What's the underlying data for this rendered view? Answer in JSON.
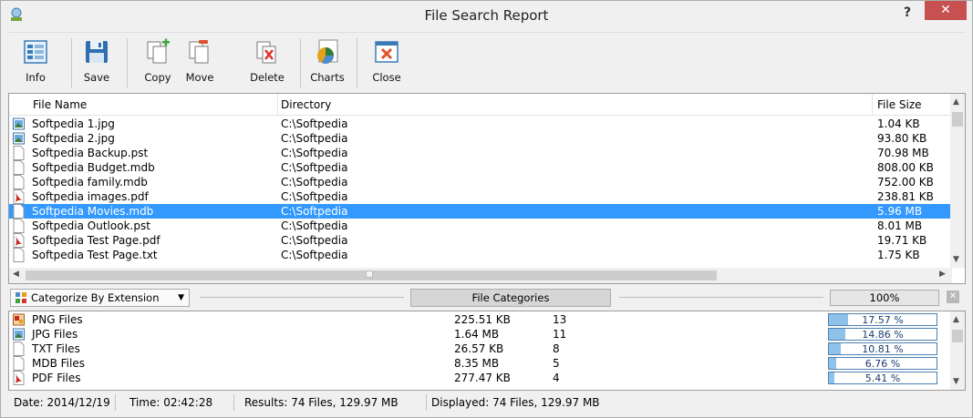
{
  "window": {
    "title": "File Search Report",
    "help_label": "?",
    "close_label": "✕"
  },
  "toolbar": {
    "buttons": [
      {
        "label": "Info",
        "icon": "info-icon"
      },
      {
        "label": "Save",
        "icon": "floppy-disk-icon"
      },
      {
        "label": "Copy",
        "icon": "copy-files-icon"
      },
      {
        "label": "Move",
        "icon": "move-files-icon"
      },
      {
        "label": "Delete",
        "icon": "delete-files-icon"
      },
      {
        "label": "Charts",
        "icon": "pie-chart-icon"
      },
      {
        "label": "Close",
        "icon": "close-window-icon"
      }
    ]
  },
  "files": {
    "columns": {
      "name": "File Name",
      "directory": "Directory",
      "size": "File Size"
    },
    "rows": [
      {
        "name": "Softpedia 1.jpg",
        "directory": "C:\\Softpedia",
        "size": "1.04 KB",
        "icon": "image-file-icon"
      },
      {
        "name": "Softpedia 2.jpg",
        "directory": "C:\\Softpedia",
        "size": "93.80 KB",
        "icon": "image-file-icon"
      },
      {
        "name": "Softpedia Backup.pst",
        "directory": "C:\\Softpedia",
        "size": "70.98 MB",
        "icon": "generic-file-icon"
      },
      {
        "name": "Softpedia Budget.mdb",
        "directory": "C:\\Softpedia",
        "size": "808.00 KB",
        "icon": "generic-file-icon"
      },
      {
        "name": "Softpedia family.mdb",
        "directory": "C:\\Softpedia",
        "size": "752.00 KB",
        "icon": "generic-file-icon"
      },
      {
        "name": "Softpedia images.pdf",
        "directory": "C:\\Softpedia",
        "size": "238.81 KB",
        "icon": "pdf-file-icon"
      },
      {
        "name": "Softpedia Movies.mdb",
        "directory": "C:\\Softpedia",
        "size": "5.96 MB",
        "icon": "generic-file-icon"
      },
      {
        "name": "Softpedia Outlook.pst",
        "directory": "C:\\Softpedia",
        "size": "8.01 MB",
        "icon": "generic-file-icon"
      },
      {
        "name": "Softpedia Test Page.pdf",
        "directory": "C:\\Softpedia",
        "size": "19.71 KB",
        "icon": "pdf-file-icon"
      },
      {
        "name": "Softpedia Test Page.txt",
        "directory": "C:\\Softpedia",
        "size": "1.75 KB",
        "icon": "generic-file-icon"
      }
    ],
    "selected_index": 6
  },
  "categorize": {
    "select_value": "Categorize By Extension",
    "label": "File Categories",
    "percent": "100%",
    "close_label": "✕"
  },
  "categories": [
    {
      "name": "PNG Files",
      "size": "225.51 KB",
      "count": "13",
      "percent": "17.57 %",
      "fraction": 0.1757,
      "icon": "png-file-icon"
    },
    {
      "name": "JPG Files",
      "size": "1.64 MB",
      "count": "11",
      "percent": "14.86 %",
      "fraction": 0.1486,
      "icon": "image-file-icon"
    },
    {
      "name": "TXT Files",
      "size": "26.57 KB",
      "count": "8",
      "percent": "10.81 %",
      "fraction": 0.1081,
      "icon": "generic-file-icon"
    },
    {
      "name": "MDB Files",
      "size": "8.35 MB",
      "count": "5",
      "percent": "6.76 %",
      "fraction": 0.0676,
      "icon": "generic-file-icon"
    },
    {
      "name": "PDF Files",
      "size": "277.47 KB",
      "count": "4",
      "percent": "5.41 %",
      "fraction": 0.0541,
      "icon": "pdf-file-icon"
    }
  ],
  "status": {
    "date": "Date: 2014/12/19",
    "time": "Time: 02:42:28",
    "results": "Results: 74 Files, 129.97 MB",
    "displayed": "Displayed: 74 Files, 129.97 MB"
  },
  "colors": {
    "selection": "#3399ff",
    "close_button": "#c75050",
    "progress_fill": "#8ec2ea"
  }
}
